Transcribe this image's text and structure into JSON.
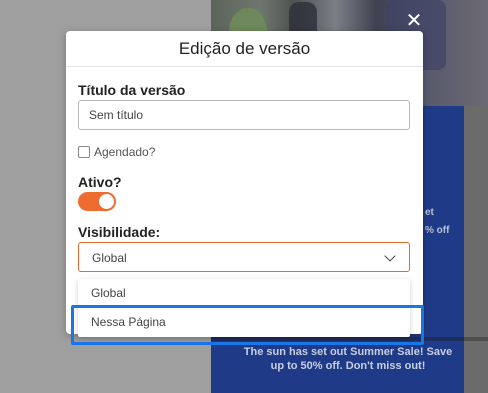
{
  "modal": {
    "title": "Edição de versão",
    "close_icon": "close-icon",
    "version_title_label": "Título da versão",
    "version_title_value": "Sem título",
    "scheduled_label": "Agendado?",
    "scheduled_checked": false,
    "active_label": "Ativo?",
    "active_on": true,
    "visibility_label": "Visibilidade:",
    "visibility_selected": "Global",
    "visibility_options": [
      "Global",
      "Nessa Página"
    ]
  },
  "background": {
    "promo_text": "The sun has set out Summer Sale! Save up to 50% off. Don't miss out!",
    "snippet_1": "et",
    "snippet_2": "% off"
  },
  "colors": {
    "accent": "#ee6c2f",
    "select_border": "#e06a33",
    "highlight": "#1976e8",
    "promo_blue": "#1f3a86"
  }
}
